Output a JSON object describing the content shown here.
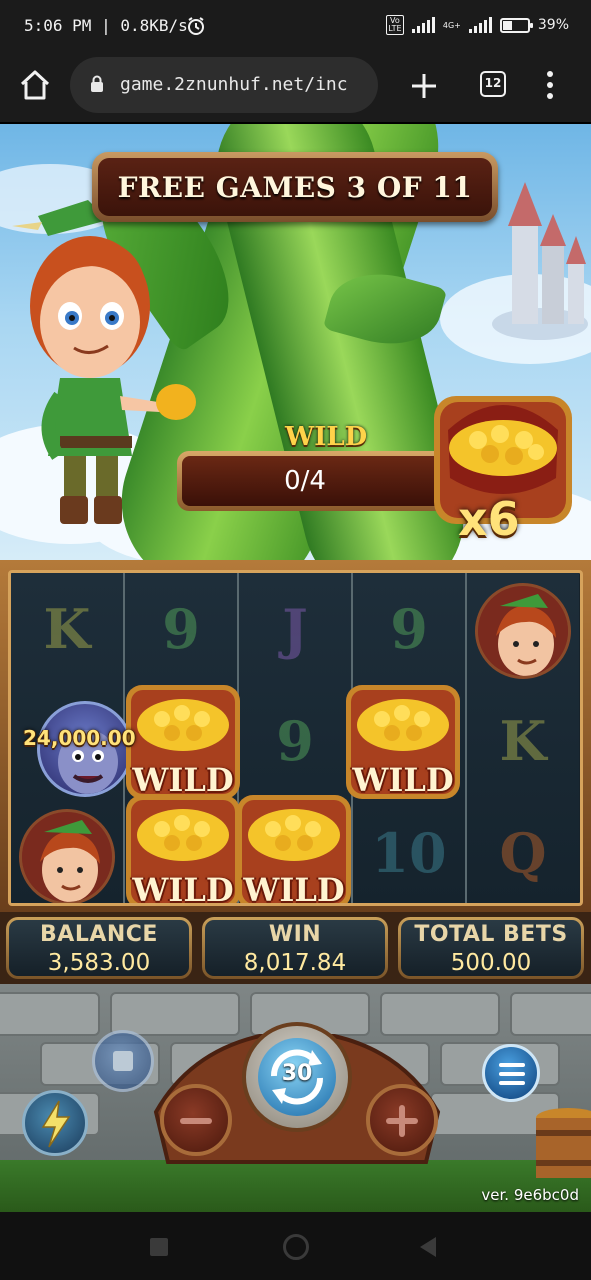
{
  "status_bar": {
    "time": "5:06 PM | 0.8KB/s",
    "network_tag": "4G+",
    "volte_tag": "Vo LTE",
    "battery": "39%",
    "battery_level": 0.39
  },
  "browser": {
    "url": "game.2znunhuf.net/inc",
    "tab_count": "12"
  },
  "game": {
    "free_games_banner": "FREE GAMES 3 OF 11",
    "wild_label": "WILD",
    "wild_progress": "0/4",
    "multiplier": "x6",
    "win_popup": "24,000.00",
    "wild_text": "WILD",
    "reels": [
      [
        "K",
        "portrait-goblin",
        "portrait-jack"
      ],
      [
        "9",
        "WILD",
        "WILD"
      ],
      [
        "J",
        "9",
        "WILD"
      ],
      [
        "9",
        "WILD",
        "10"
      ],
      [
        "portrait-jack",
        "K",
        "Q"
      ]
    ],
    "balance_label": "BALANCE",
    "balance_value": "3,583.00",
    "win_label": "WIN",
    "win_value": "8,017.84",
    "total_bets_label": "TOTAL BETS",
    "total_bets_value": "500.00",
    "spin_count": "30",
    "version": "ver. 9e6bc0d"
  },
  "icons": {
    "home": "home-icon",
    "lock": "lock-icon",
    "new_tab": "plus-icon",
    "tabs": "tab-switcher-icon",
    "menu": "more-vert-icon",
    "stop": "stop-square-icon",
    "turbo": "lightning-icon",
    "spin": "refresh-arrows-icon",
    "decrease": "minus-icon",
    "increase": "plus-icon",
    "game_menu": "hamburger-icon"
  },
  "colors": {
    "gold_text": "#ffe27a",
    "panel_dark": "#152028",
    "wood": "#7a4e2c"
  }
}
